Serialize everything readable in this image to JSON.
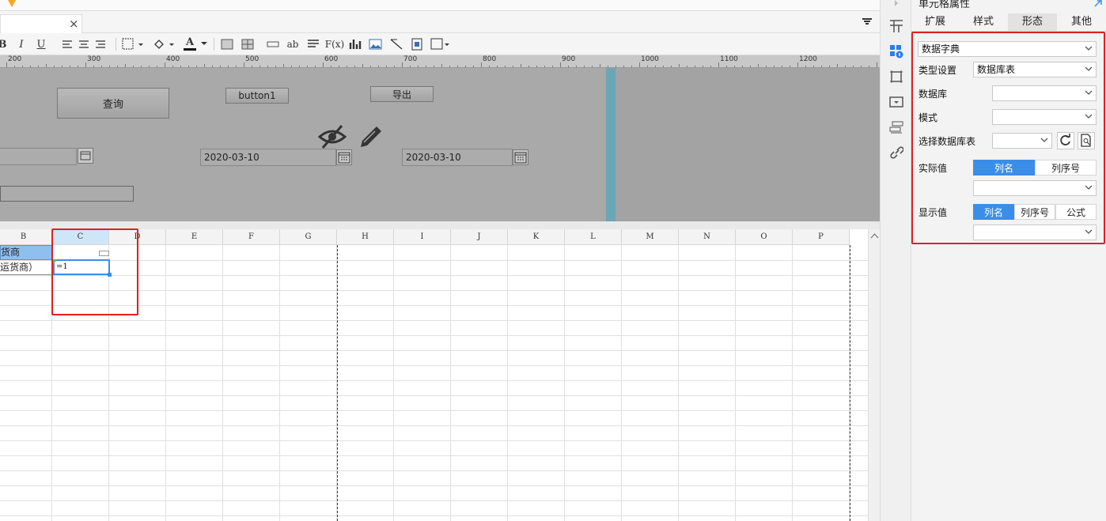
{
  "tab": {
    "close": "×"
  },
  "toolbar": {
    "bold": "B",
    "italic": "I",
    "underline": "U",
    "font_color_letter": "A",
    "text_btn": "ab",
    "formula_btn": "F(x)"
  },
  "ruler": {
    "labels": [
      "200",
      "300",
      "400",
      "500",
      "600",
      "700",
      "800",
      "900",
      "1000",
      "1100",
      "1200"
    ]
  },
  "form": {
    "query_button": "查询",
    "button1": "button1",
    "export_button": "导出",
    "date1": "2020-03-10",
    "date2": "2020-03-10"
  },
  "sheet": {
    "columns": [
      "B",
      "C",
      "D",
      "E",
      "F",
      "G",
      "H",
      "I",
      "J",
      "K",
      "L",
      "M",
      "N",
      "O",
      "P"
    ],
    "cell_b2": "货商",
    "cell_b3": "运货商）",
    "cell_c3": "=1"
  },
  "panel": {
    "title": "单元格属性",
    "tabs": [
      {
        "label": "扩展"
      },
      {
        "label": "样式"
      },
      {
        "label": "形态",
        "active": true
      },
      {
        "label": "其他"
      }
    ],
    "form_type": "数据字典",
    "type_setting_label": "类型设置",
    "type_setting_value": "数据库表",
    "database_label": "数据库",
    "database_value": "",
    "mode_label": "模式",
    "mode_value": "",
    "table_label": "选择数据库表",
    "table_value": "",
    "actual_label": "实际值",
    "actual_options": [
      "列名",
      "列序号"
    ],
    "display_label": "显示值",
    "display_options": [
      "列名",
      "列序号",
      "公式"
    ]
  },
  "colors": {
    "accent": "#3b8ee8",
    "highlight_red": "#e02020",
    "selected_col": "#cfe6f8",
    "blue_cell": "#8fbfef"
  }
}
